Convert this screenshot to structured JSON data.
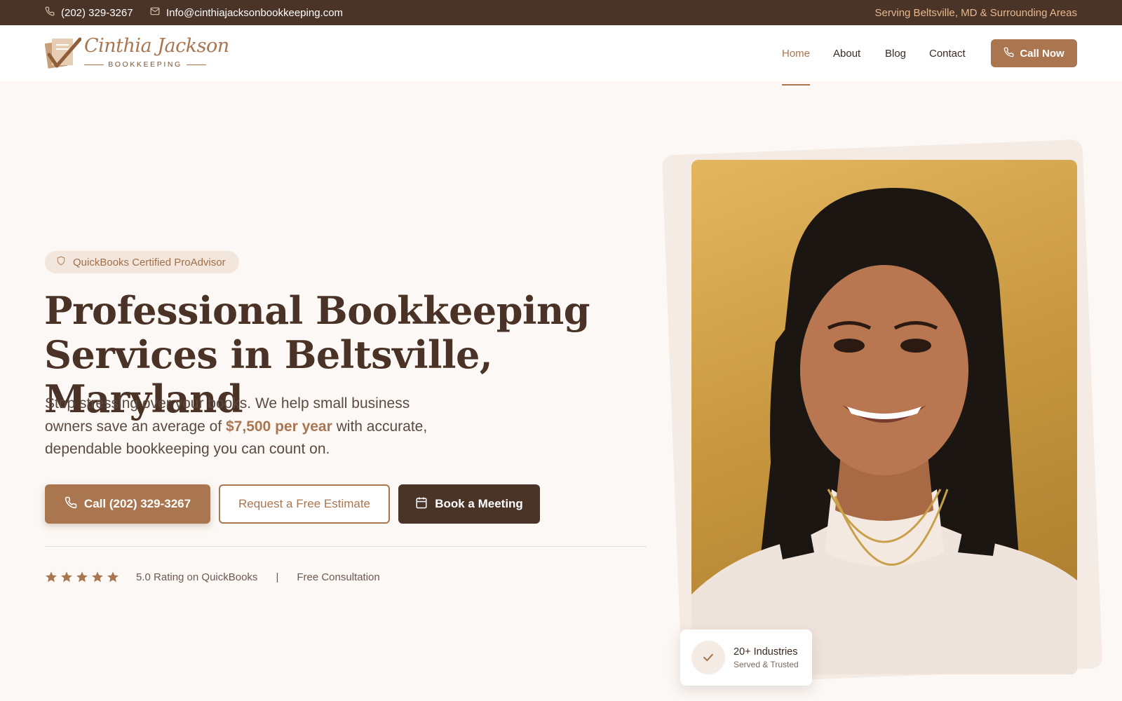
{
  "topbar": {
    "phone": "(202) 329-3267",
    "email": "Info@cinthiajacksonbookkeeping.com",
    "service_area": "Serving Beltsville, MD & Surrounding Areas"
  },
  "header": {
    "logo_name": "Cinthia Jackson",
    "logo_sub": "BOOKKEEPING",
    "nav": [
      {
        "label": "Home",
        "active": true
      },
      {
        "label": "About"
      },
      {
        "label": "Blog"
      },
      {
        "label": "Contact"
      }
    ],
    "cta": "Call Now"
  },
  "hero": {
    "badge": "QuickBooks Certified ProAdvisor",
    "headline_line1": "Professional Bookkeeping",
    "headline_line2": "Services in Beltsville, Maryland",
    "lead_part1": "Stop stressing over your books. We help small business owners save an average of ",
    "lead_highlight": "$7,500 per year",
    "lead_part2": " with accurate, dependable bookkeeping you can count on.",
    "buttons": {
      "call": "Call (202) 329-3267",
      "estimate": "Request a Free Estimate",
      "meeting": "Book a Meeting"
    },
    "stars": 5,
    "rating_text": "5.0 Rating on QuickBooks",
    "separator": "|",
    "free_consultation": "Free Consultation",
    "card_title": "20+ Industries",
    "card_sub": "Served & Trusted"
  },
  "colors": {
    "brand": "#a97650",
    "dark": "#4a3428",
    "background": "#fcf8f5"
  },
  "icons": [
    "phone-icon",
    "mail-icon",
    "shield-icon",
    "calendar-icon",
    "star-icon",
    "check-icon"
  ]
}
